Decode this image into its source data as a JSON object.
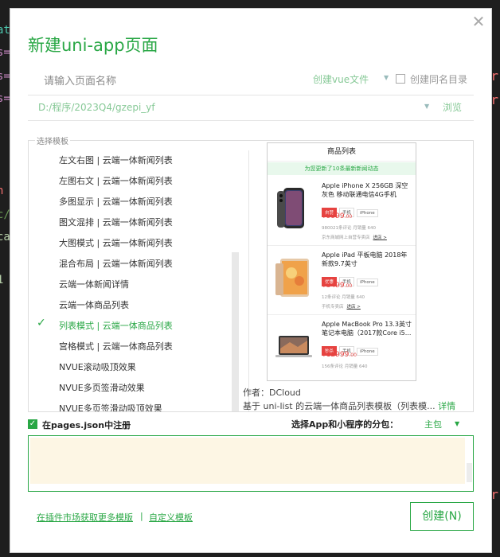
{
  "colors": {
    "accent": "#29a745",
    "editor_bg": "#1e1e1e"
  },
  "background_code": {
    "left_fragments": [
      "at",
      "s=",
      "s=",
      "s=",
      "n",
      "c/",
      "ca",
      "1"
    ],
    "right_fragments": [
      "r",
      "r",
      "r"
    ]
  },
  "dialog": {
    "title": "新建uni-app页面",
    "close_icon": "close-icon",
    "name_input": {
      "value": "",
      "placeholder": "请输入页面名称"
    },
    "vue_select": "创建vue文件",
    "same_dir_label": "创建同名目录",
    "path": "D:/程序/2023Q4/gzepi_yf",
    "browse_label": "浏览",
    "template_group_label": "选择模板",
    "templates": [
      {
        "label": "左文右图 | 云端一体新闻列表",
        "selected": false
      },
      {
        "label": "左图右文 | 云端一体新闻列表",
        "selected": false
      },
      {
        "label": "多图显示 | 云端一体新闻列表",
        "selected": false
      },
      {
        "label": "图文混排 | 云端一体新闻列表",
        "selected": false
      },
      {
        "label": "大图模式 | 云端一体新闻列表",
        "selected": false
      },
      {
        "label": "混合布局 | 云端一体新闻列表",
        "selected": false
      },
      {
        "label": "云端一体新闻详情",
        "selected": false
      },
      {
        "label": "云端一体商品列表",
        "selected": false
      },
      {
        "label": "列表模式 | 云端一体商品列表",
        "selected": true
      },
      {
        "label": "宫格模式 | 云端一体商品列表",
        "selected": false
      },
      {
        "label": "NVUE滚动吸顶效果",
        "selected": false
      },
      {
        "label": "NVUE多页签滑动效果",
        "selected": false
      },
      {
        "label": "NVUE多页签滑动吸顶效果",
        "selected": false
      }
    ],
    "preview": {
      "title": "商品列表",
      "banner": "为您更新了10条最新新闻动态",
      "items": [
        {
          "name": "Apple iPhone X 256GB 深空灰色 移动联通电信4G手机",
          "tags": [
            "自营",
            "手机",
            "iPhone"
          ],
          "price": "¥9999",
          "price_cents": ".00",
          "meta": "980021条评论  月销量 640",
          "shop": "京东商城网上自营专卖店",
          "shop_link": "进店 >"
        },
        {
          "name": "Apple iPad 平板电脑 2018年新款9.7英寸",
          "tags": [
            "优惠",
            "手机",
            "iPhone"
          ],
          "price": "¥3499",
          "price_cents": ".00",
          "meta": "12条评论  月销量 640",
          "shop": "手机专卖店",
          "shop_link": "进店 >"
        },
        {
          "name": "Apple MacBook Pro 13.3英寸笔记本电脑（2017款Core i5...",
          "tags": [
            "秒杀",
            "手机",
            "iPhone"
          ],
          "price": "¥12999",
          "price_cents": ".00",
          "meta": "156条评论  月销量 640",
          "shop": "",
          "shop_link": ""
        }
      ]
    },
    "author": "作者：DCloud",
    "description": "基于 uni-list 的云端一体商品列表模板（列表模...",
    "description_more": "详情",
    "register_label": "在pages.json中注册",
    "package_label": "选择App和小程序的分包：",
    "package_value": "主包",
    "footer": {
      "more_templates": "在插件市场获取更多模版",
      "divider": "|",
      "custom_template": "自定义模板",
      "create_button": "创建(N)"
    }
  }
}
